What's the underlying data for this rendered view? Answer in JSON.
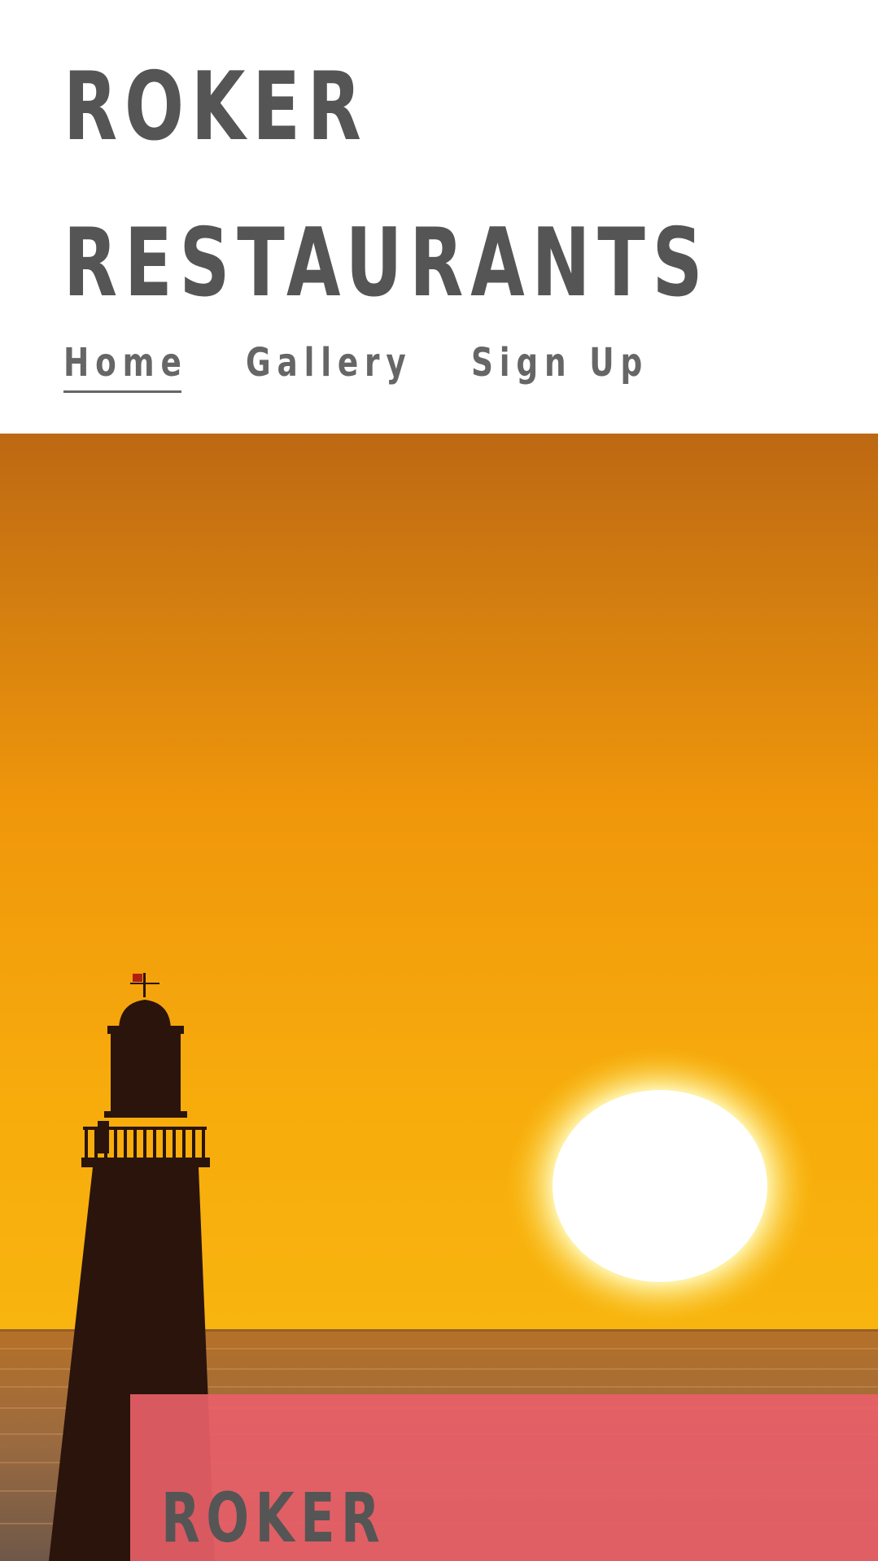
{
  "site": {
    "title_line1": "ROKER",
    "title_line2": "RESTAURANTS"
  },
  "nav": {
    "items": [
      {
        "label": "Home",
        "active": true
      },
      {
        "label": "Gallery",
        "active": false
      },
      {
        "label": "Sign Up",
        "active": false
      }
    ]
  },
  "hero": {
    "image_subject": "lighthouse-sunset",
    "colors": {
      "sky_top": "#c06a12",
      "sky_mid": "#f29b0c",
      "sky_bottom": "#f7b20e",
      "sun": "#ffffff",
      "silhouette": "#2a140c",
      "sea": "#b8742a"
    }
  },
  "card": {
    "title": "ROKER",
    "background": "#e86068"
  }
}
